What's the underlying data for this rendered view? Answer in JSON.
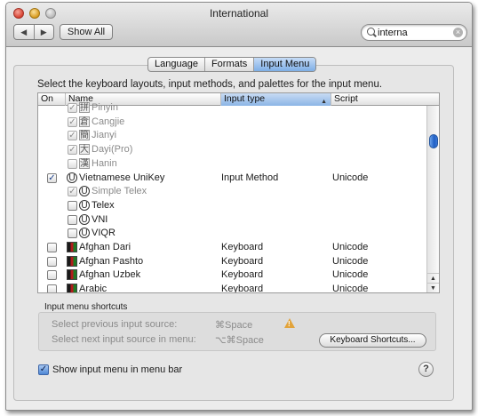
{
  "window": {
    "title": "International"
  },
  "toolbar": {
    "back_glyph": "◀",
    "forward_glyph": "▶",
    "show_all_label": "Show All",
    "search_value": "interna",
    "clear_glyph": "×"
  },
  "tabs": [
    {
      "label": "Language",
      "active": false
    },
    {
      "label": "Formats",
      "active": false
    },
    {
      "label": "Input Menu",
      "active": true
    }
  ],
  "instruction": "Select the keyboard layouts, input methods, and palettes for the input menu.",
  "table": {
    "headers": {
      "on": "On",
      "name": "Name",
      "input_type": "Input type",
      "script": "Script",
      "sort_glyph": "▲"
    },
    "rows": [
      {
        "name": "Pinyin",
        "input_type": "",
        "script": "",
        "checked": true,
        "indent": true,
        "dimmed": true,
        "icon": "chinese-char-icon",
        "glyph": "拼"
      },
      {
        "name": "Cangjie",
        "input_type": "",
        "script": "",
        "checked": true,
        "indent": true,
        "dimmed": true,
        "icon": "chinese-char-icon",
        "glyph": "倉"
      },
      {
        "name": "Jianyi",
        "input_type": "",
        "script": "",
        "checked": true,
        "indent": true,
        "dimmed": true,
        "icon": "chinese-char-icon",
        "glyph": "簡"
      },
      {
        "name": "Dayi(Pro)",
        "input_type": "",
        "script": "",
        "checked": true,
        "indent": true,
        "dimmed": true,
        "icon": "chinese-char-icon",
        "glyph": "大"
      },
      {
        "name": "Hanin",
        "input_type": "",
        "script": "",
        "checked": false,
        "indent": true,
        "dimmed": true,
        "icon": "chinese-char-icon",
        "glyph": "漢"
      },
      {
        "name": "Vietnamese UniKey",
        "input_type": "Input Method",
        "script": "Unicode",
        "checked": true,
        "indent": false,
        "dimmed": false,
        "icon": "globe-icon",
        "glyph": "U"
      },
      {
        "name": "Simple Telex",
        "input_type": "",
        "script": "",
        "checked": true,
        "indent": true,
        "dimmed": true,
        "icon": "globe-icon",
        "glyph": "U"
      },
      {
        "name": "Telex",
        "input_type": "",
        "script": "",
        "checked": false,
        "indent": true,
        "dimmed": false,
        "icon": "globe-icon",
        "glyph": "U"
      },
      {
        "name": "VNI",
        "input_type": "",
        "script": "",
        "checked": false,
        "indent": true,
        "dimmed": false,
        "icon": "globe-icon",
        "glyph": "U"
      },
      {
        "name": "VIQR",
        "input_type": "",
        "script": "",
        "checked": false,
        "indent": true,
        "dimmed": false,
        "icon": "globe-icon",
        "glyph": "U"
      },
      {
        "name": "Afghan Dari",
        "input_type": "Keyboard",
        "script": "Unicode",
        "checked": false,
        "indent": false,
        "dimmed": false,
        "icon": "flag-icon",
        "glyph": ""
      },
      {
        "name": "Afghan Pashto",
        "input_type": "Keyboard",
        "script": "Unicode",
        "checked": false,
        "indent": false,
        "dimmed": false,
        "icon": "flag-icon",
        "glyph": ""
      },
      {
        "name": "Afghan Uzbek",
        "input_type": "Keyboard",
        "script": "Unicode",
        "checked": false,
        "indent": false,
        "dimmed": false,
        "icon": "flag-icon",
        "glyph": ""
      },
      {
        "name": "Arabic",
        "input_type": "Keyboard",
        "script": "Unicode",
        "checked": false,
        "indent": false,
        "dimmed": false,
        "icon": "flag-icon",
        "glyph": ""
      }
    ],
    "check_glyph": "✓",
    "scroll_up_glyph": "▲",
    "scroll_down_glyph": "▼"
  },
  "shortcuts": {
    "section_label": "Input menu shortcuts",
    "previous_label": "Select previous input source:",
    "previous_key": "⌘Space",
    "next_label": "Select next input source in menu:",
    "next_key": "⌥⌘Space",
    "warning_glyph": "!",
    "keyboard_shortcuts_button": "Keyboard Shortcuts..."
  },
  "show_menu": {
    "label": "Show input menu in menu bar",
    "checked": true,
    "check_glyph": "✓"
  },
  "help_glyph": "?"
}
